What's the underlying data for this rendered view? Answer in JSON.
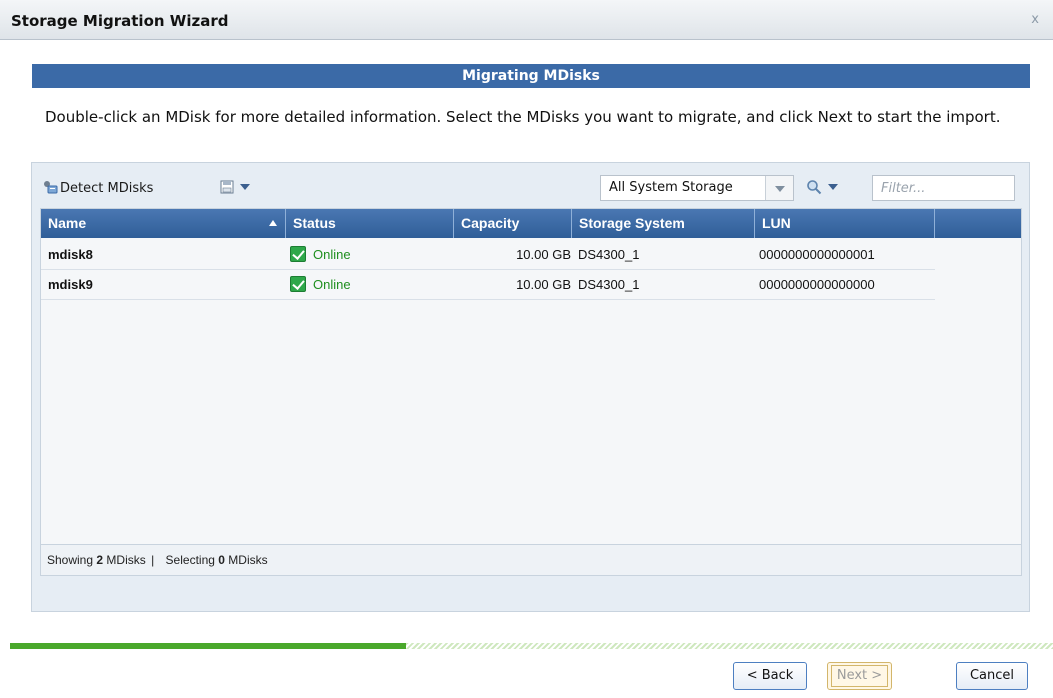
{
  "window": {
    "title": "Storage Migration Wizard",
    "close_label": "x"
  },
  "section": {
    "title": "Migrating MDisks"
  },
  "instructions": "Double-click an MDisk for more detailed information. Select the MDisks you want to migrate, and click Next to start the import.",
  "toolbar": {
    "detect_label": "Detect MDisks",
    "storage_filter_value": "All System Storage",
    "filter_placeholder": "Filter..."
  },
  "table": {
    "columns": [
      "Name",
      "Status",
      "Capacity",
      "Storage System",
      "LUN"
    ],
    "sort_column": "Name",
    "sort_direction": "ascending",
    "rows": [
      {
        "name": "mdisk8",
        "status": "Online",
        "capacity": "10.00 GB",
        "storage_system": "DS4300_1",
        "lun": "0000000000000001"
      },
      {
        "name": "mdisk9",
        "status": "Online",
        "capacity": "10.00 GB",
        "storage_system": "DS4300_1",
        "lun": "0000000000000000"
      }
    ],
    "footer": {
      "showing_prefix": "Showing",
      "showing_count": "2",
      "showing_suffix": "MDisks",
      "separator": "|",
      "selecting_prefix": "Selecting",
      "selecting_count": "0",
      "selecting_suffix": "MDisks"
    }
  },
  "progress": {
    "fraction": 0.38
  },
  "buttons": {
    "back": "< Back",
    "next": "Next >",
    "cancel": "Cancel"
  },
  "colors": {
    "header_blue": "#3b6aa7",
    "status_green": "#1f8f1f",
    "progress_green": "#4aa82b"
  }
}
